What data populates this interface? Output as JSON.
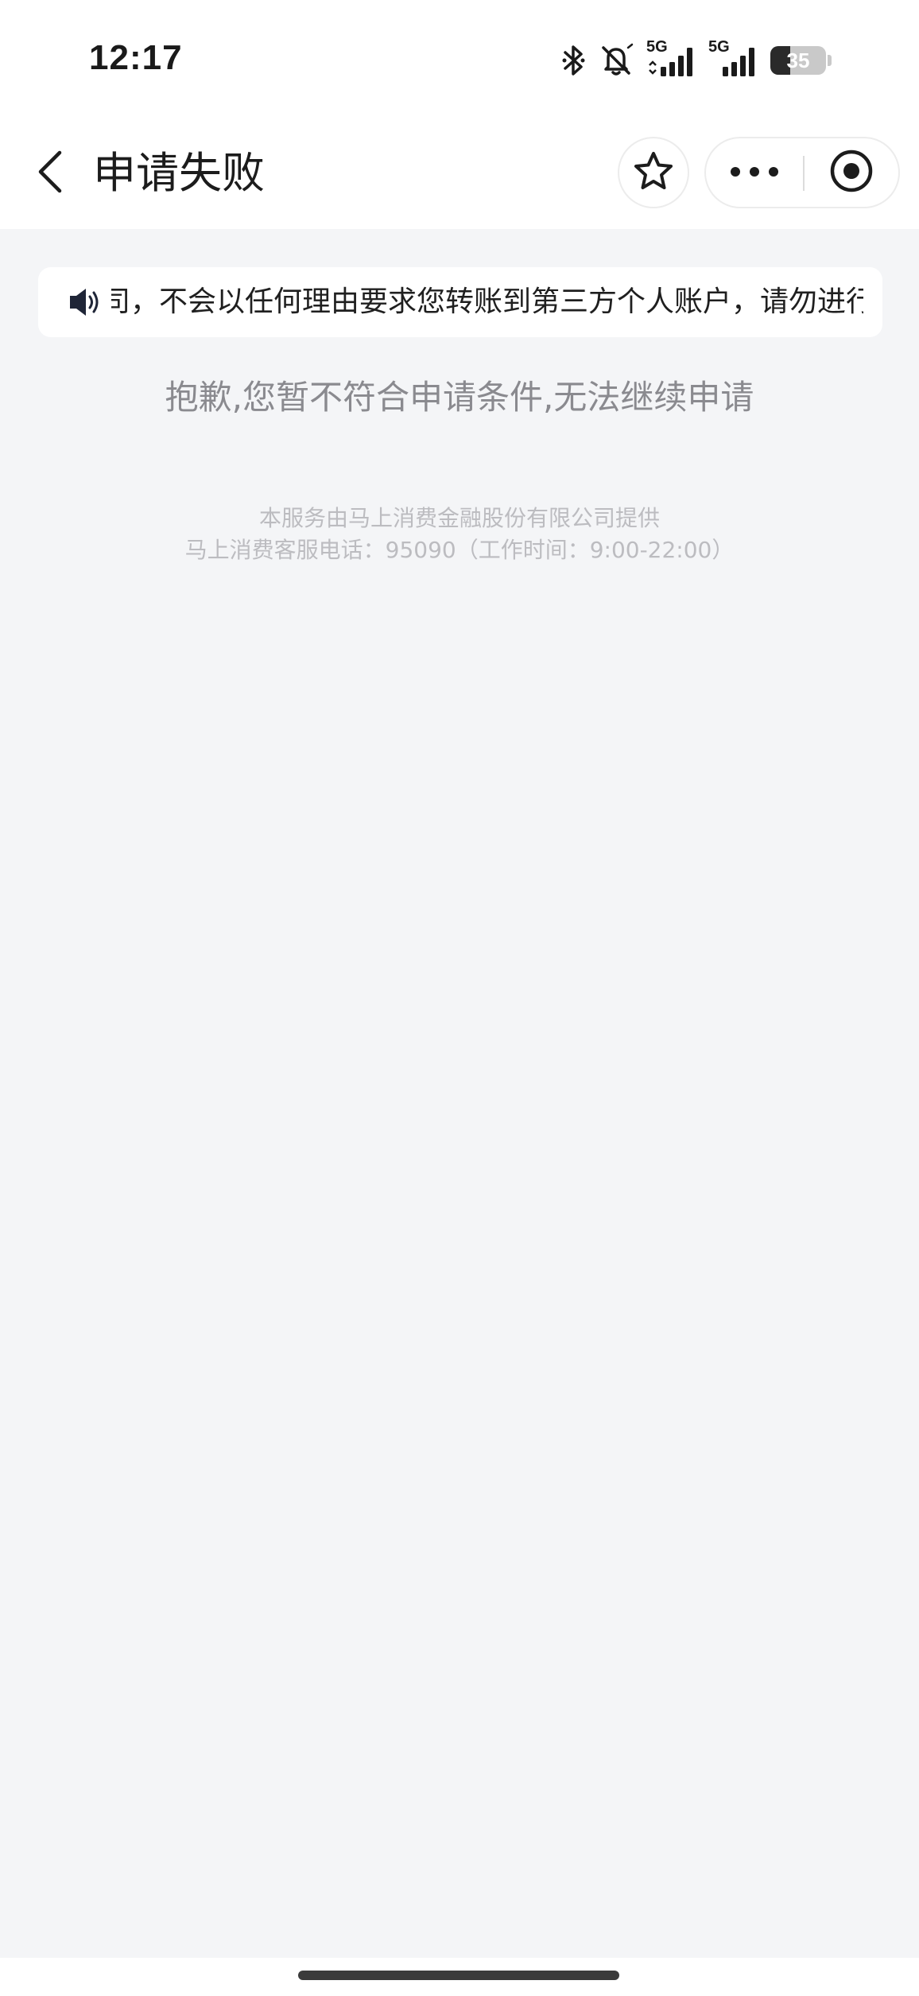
{
  "status_bar": {
    "time": "12:17",
    "network_1": "5G",
    "network_2": "5G",
    "battery_percent": 35,
    "battery_label": "35",
    "icons": [
      "bluetooth-icon",
      "mute-bell-icon",
      "signal-5g-icon",
      "signal-5g-icon",
      "battery-icon"
    ]
  },
  "nav": {
    "title": "申请失败",
    "icons": [
      "back-arrow-icon",
      "star-icon",
      "more-dots-icon",
      "target-close-icon"
    ]
  },
  "notice": {
    "icon": "speaker-icon",
    "text": "司，不会以任何理由要求您转账到第三方个人账户，请勿进行"
  },
  "message": {
    "text": "抱歉,您暂不符合申请条件,无法继续申请"
  },
  "footer": {
    "provider": "本服务由马上消费金融股份有限公司提供",
    "hotline": "马上消费客服电话：95090（工作时间：9:00-22:00）"
  },
  "colors": {
    "page_background": "#f4f5f7",
    "bar_background": "#ffffff",
    "message_text": "#8a8a8f",
    "footer_text": "#bcbcc0"
  }
}
